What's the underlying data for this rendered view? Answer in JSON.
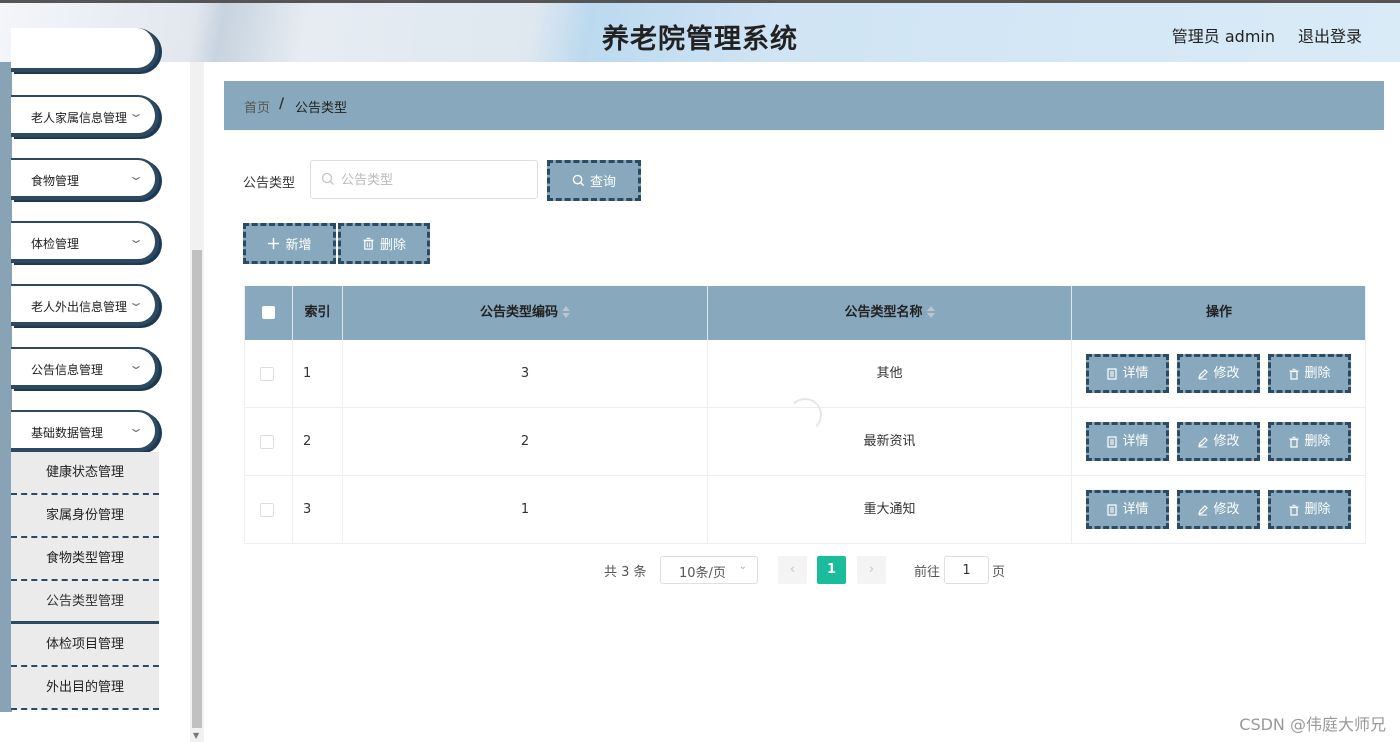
{
  "header": {
    "title": "养老院管理系统",
    "user": "管理员 admin",
    "logout": "退出登录"
  },
  "sidebar": {
    "menus": [
      {
        "label": ""
      },
      {
        "label": "老人家属信息管理"
      },
      {
        "label": "食物管理"
      },
      {
        "label": "体检管理"
      },
      {
        "label": "老人外出信息管理"
      },
      {
        "label": "公告信息管理"
      },
      {
        "label": "基础数据管理"
      }
    ],
    "submenu": [
      {
        "label": "健康状态管理"
      },
      {
        "label": "家属身份管理"
      },
      {
        "label": "食物类型管理"
      },
      {
        "label": "公告类型管理"
      },
      {
        "label": "体检项目管理"
      },
      {
        "label": "外出目的管理"
      }
    ],
    "active_submenu": "公告类型管理"
  },
  "breadcrumb": {
    "home": "首页",
    "separator": "/",
    "current": "公告类型"
  },
  "search": {
    "label": "公告类型",
    "placeholder": "公告类型",
    "value": "",
    "button": "查询"
  },
  "toolbar": {
    "add": "新增",
    "delete": "删除"
  },
  "table": {
    "columns": [
      "索引",
      "公告类型编码",
      "公告类型名称",
      "操作"
    ],
    "rows": [
      {
        "index": "1",
        "code": "3",
        "name": "其他"
      },
      {
        "index": "2",
        "code": "2",
        "name": "最新资讯"
      },
      {
        "index": "3",
        "code": "1",
        "name": "重大通知"
      }
    ],
    "actions": {
      "detail": "详情",
      "edit": "修改",
      "delete": "删除"
    }
  },
  "pagination": {
    "total": "共 3 条",
    "page_size": "10条/页",
    "prev": "‹",
    "current_page": "1",
    "next": "›",
    "goto_label": "前往",
    "goto_value": "1",
    "page_suffix": "页"
  },
  "watermark": "CSDN @伟庭大师兄",
  "colors": {
    "accent": "#88a9bd",
    "dark_border": "#2d4a63",
    "active_page": "#1abc9c"
  }
}
